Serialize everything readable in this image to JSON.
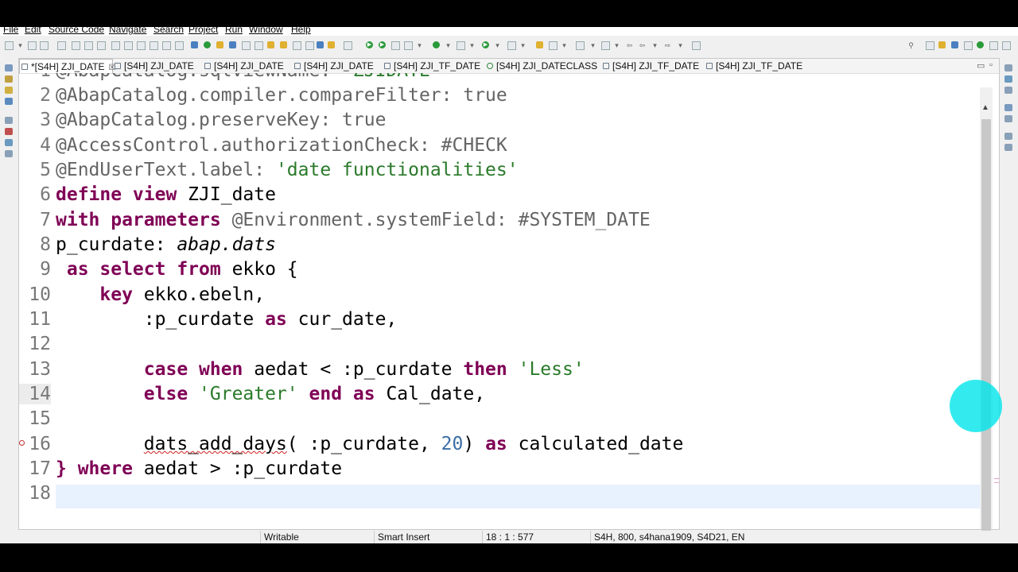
{
  "menu": [
    "File",
    "Edit",
    "Source Code",
    "Navigate",
    "Search",
    "Project",
    "Run",
    "Window",
    "Help"
  ],
  "tabs": [
    {
      "label": "*[S4H] ZJI_DATE",
      "active": true,
      "close": "☒"
    },
    {
      "label": "[S4H] ZJI_DATE"
    },
    {
      "label": "[S4H] ZJI_DATE"
    },
    {
      "label": "[S4H] ZJI_DATE"
    },
    {
      "label": "[S4H] ZJI_TF_DATE"
    },
    {
      "label": "[S4H] ZJI_DATECLASS"
    },
    {
      "label": "[S4H] ZJI_TF_DATE"
    },
    {
      "label": "[S4H] ZJI_TF_DATE"
    }
  ],
  "window_controls": {
    "minimize": "▭",
    "maximize": "▫"
  },
  "line_numbers": [
    "1",
    "2",
    "3",
    "4",
    "5",
    "6",
    "7",
    "8",
    "9",
    "10",
    "11",
    "12",
    "13",
    "14",
    "15",
    "16",
    "17",
    "18"
  ],
  "code": {
    "l1a": "@AbapCatalog.sqlViewName: ",
    "l1b": "'ZJIDATE'",
    "l2": "@AbapCatalog.compiler.compareFilter: true",
    "l3": "@AbapCatalog.preserveKey: true",
    "l4": "@AccessControl.authorizationCheck: #CHECK",
    "l5a": "@EndUserText.label: ",
    "l5b": "'date functionalities'",
    "l6a": "define view",
    "l6b": " ZJI_date",
    "l7a": "with parameters",
    "l7b": " @Environment.systemField: #SYSTEM_DATE",
    "l8a": "p_curdate: ",
    "l8b": "abap.dats",
    "l9a": " as select from",
    "l9b": " ekko {",
    "l10a": "    key",
    "l10b": " ekko.ebeln,",
    "l11a": "        :p_curdate ",
    "l11b": "as",
    "l11c": " cur_date,",
    "l13a": "        case when",
    "l13b": " aedat < :p_curdate ",
    "l13c": "then",
    "l13d": " ",
    "l13e": "'Less'",
    "l14a": "        else",
    "l14b": " ",
    "l14c": "'Greater'",
    "l14d": " ",
    "l14e": "end as",
    "l14f": " Cal_date,",
    "l16a": "        ",
    "l16b": "dats_add_days",
    "l16c": "( :p_curdate, ",
    "l16d": "20",
    "l16e": ") ",
    "l16f": "as",
    "l16g": " calculated_date",
    "l17a": "} ",
    "l17b": "where",
    "l17c": " aedat > :p_curdate"
  },
  "status": {
    "writable": "Writable",
    "insert_mode": "Smart Insert",
    "position": "18 : 1 : 577",
    "system": "S4H, 800, s4hana1909, S4D21, EN"
  },
  "colors": {
    "keyword": "#7f0055",
    "string": "#2a7a2a",
    "annotation": "#646464",
    "number": "#3a6ea5",
    "cursor_highlight": "#00e6eb"
  }
}
